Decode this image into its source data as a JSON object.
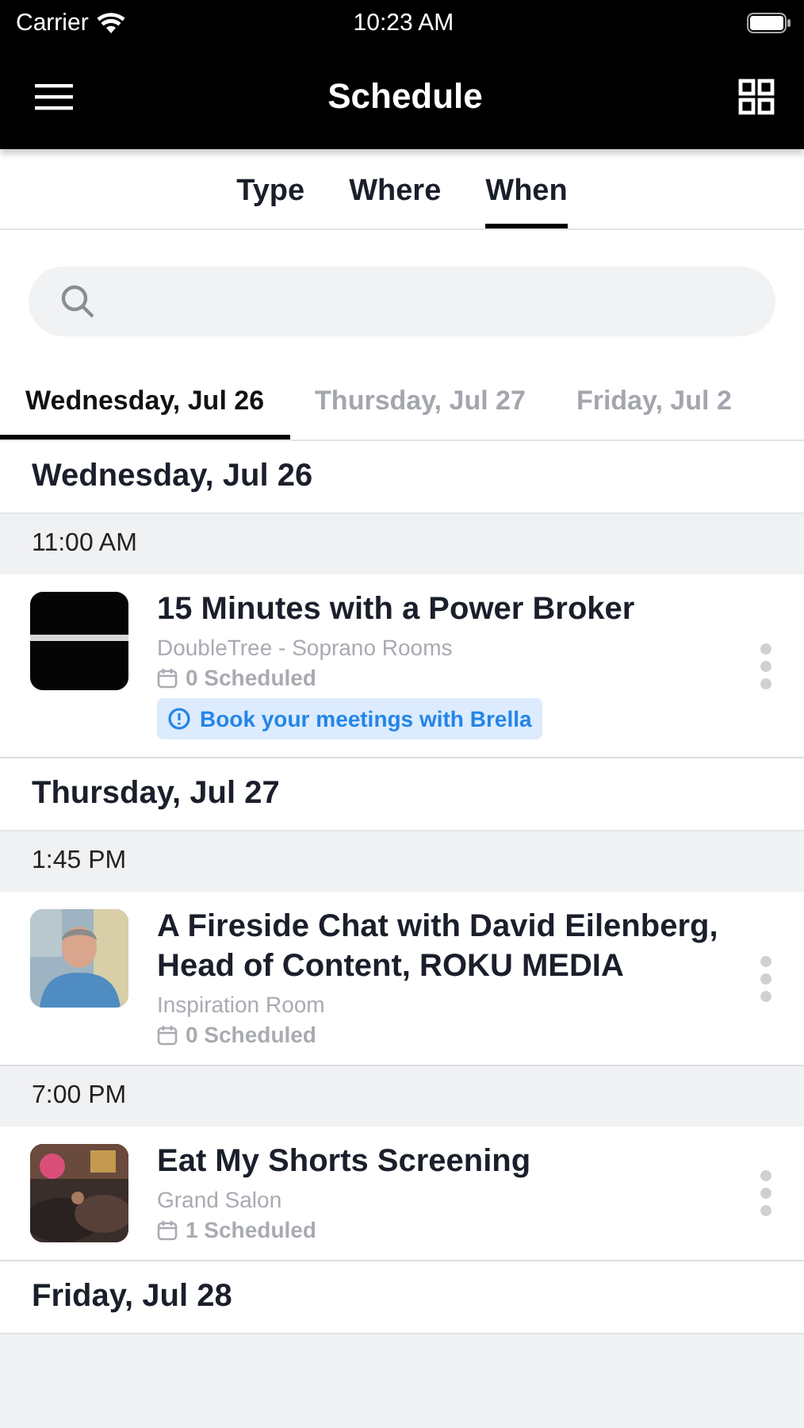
{
  "status_bar": {
    "carrier": "Carrier",
    "time": "10:23 AM"
  },
  "nav_bar": {
    "title": "Schedule"
  },
  "filter_tabs": [
    {
      "label": "Type",
      "selected": false
    },
    {
      "label": "Where",
      "selected": false
    },
    {
      "label": "When",
      "selected": true
    }
  ],
  "day_tabs": [
    {
      "label": "Wednesday, Jul 26",
      "selected": true
    },
    {
      "label": "Thursday, Jul 27",
      "selected": false
    },
    {
      "label": "Friday, Jul 2",
      "selected": false
    }
  ],
  "days": [
    {
      "heading": "Wednesday, Jul 26",
      "slots": [
        {
          "time": "11:00 AM",
          "events": [
            {
              "title": "15 Minutes with a Power Broker",
              "location": "DoubleTree - Soprano Rooms",
              "scheduled": "0 Scheduled",
              "notice": "Book your meetings with Brella"
            }
          ]
        }
      ]
    },
    {
      "heading": "Thursday, Jul 27",
      "slots": [
        {
          "time": "1:45 PM",
          "events": [
            {
              "title": "A Fireside Chat with David Eilenberg, Head of Content, ROKU MEDIA",
              "location": "Inspiration Room",
              "scheduled": "0 Scheduled"
            }
          ]
        },
        {
          "time": "7:00 PM",
          "events": [
            {
              "title": "Eat My Shorts Screening",
              "location": "Grand Salon",
              "scheduled": "1 Scheduled"
            }
          ]
        }
      ]
    },
    {
      "heading": "Friday, Jul 28"
    }
  ]
}
